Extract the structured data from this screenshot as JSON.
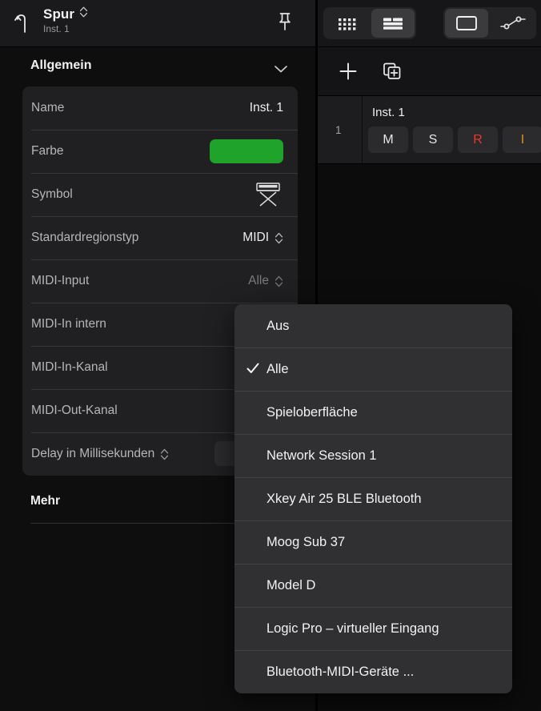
{
  "inspector": {
    "header": {
      "back_icon": "back-arrow-icon",
      "title": "Spur",
      "title_stepper_icon": "stepper-chevrons-icon",
      "subtitle": "Inst. 1",
      "pin_icon": "pin-icon"
    },
    "section": {
      "title": "Allgemein",
      "disclosure_icon": "chevron-down-icon"
    },
    "rows": [
      {
        "label": "Name",
        "value": "Inst. 1",
        "kind": "text"
      },
      {
        "label": "Farbe",
        "value": "",
        "kind": "color",
        "color": "#1fa32a"
      },
      {
        "label": "Symbol",
        "value": "",
        "kind": "symbol",
        "symbol_icon": "keyboard-stand-icon"
      },
      {
        "label": "Standardregionstyp",
        "value": "MIDI",
        "kind": "stepper"
      },
      {
        "label": "MIDI-Input",
        "value": "Alle",
        "kind": "stepper-dim"
      },
      {
        "label": "MIDI-In intern",
        "value": "",
        "kind": "plain"
      },
      {
        "label": "MIDI-In-Kanal",
        "value": "",
        "kind": "plain"
      },
      {
        "label": "MIDI-Out-Kanal",
        "value": "",
        "kind": "plain"
      },
      {
        "label": "Delay in Millisekunden",
        "value": "",
        "kind": "label-stepper"
      }
    ],
    "more_label": "Mehr"
  },
  "toolbar": {
    "groups": [
      {
        "buttons": [
          {
            "icon": "grid-dots-icon",
            "active": false
          },
          {
            "icon": "list-lines-icon",
            "active": true
          }
        ]
      },
      {
        "buttons": [
          {
            "icon": "rectangle-region-icon",
            "active": true
          },
          {
            "icon": "automation-curve-icon",
            "active": false
          }
        ]
      }
    ]
  },
  "addbar": {
    "add_icon": "plus-icon",
    "duplicate_icon": "duplicate-track-icon"
  },
  "track": {
    "number": "1",
    "name": "Inst. 1",
    "buttons": [
      {
        "label": "M",
        "name": "mute-button",
        "style": ""
      },
      {
        "label": "S",
        "name": "solo-button",
        "style": ""
      },
      {
        "label": "R",
        "name": "record-enable-button",
        "style": "rec"
      },
      {
        "label": "I",
        "name": "input-monitor-button",
        "style": "inp"
      }
    ],
    "colors": {
      "record": "#e8392c",
      "input": "#e0901f"
    }
  },
  "menu": {
    "items": [
      {
        "label": "Aus",
        "checked": false
      },
      {
        "label": "Alle",
        "checked": true
      },
      {
        "label": "Spieloberfläche",
        "checked": false
      },
      {
        "label": "Network Session 1",
        "checked": false
      },
      {
        "label": "Xkey Air 25 BLE Bluetooth",
        "checked": false
      },
      {
        "label": "Moog Sub 37",
        "checked": false
      },
      {
        "label": "Model D",
        "checked": false
      },
      {
        "label": "Logic Pro – virtueller Eingang",
        "checked": false
      },
      {
        "label": "Bluetooth-MIDI-Geräte ...",
        "checked": false
      }
    ],
    "check_icon": "checkmark-icon"
  }
}
